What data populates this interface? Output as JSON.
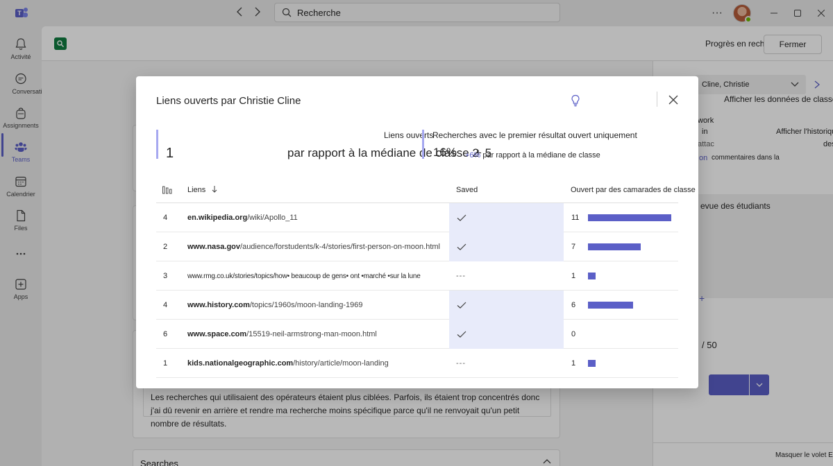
{
  "titlebar": {
    "search_placeholder": "Recherche"
  },
  "rail": {
    "items": [
      {
        "label": "Activité",
        "icon": "bell-icon"
      },
      {
        "label": "Conversation",
        "icon": "chat-icon"
      },
      {
        "label": "Assignments",
        "icon": "backpack-icon"
      },
      {
        "label": "Teams",
        "icon": "teams-people-icon"
      },
      {
        "label": "Calendrier",
        "icon": "calendar-icon"
      },
      {
        "label": "Files",
        "icon": "file-icon"
      },
      {
        "label": "",
        "icon": "more-icon"
      },
      {
        "label": "Apps",
        "icon": "apps-icon"
      }
    ]
  },
  "main": {
    "progress_title": "Progrès en recherche",
    "close_label": "Fermer",
    "student_select": "Cline, Christie",
    "show_class_data": "Afficher les données de classe",
    "right_frag_work": "work",
    "right_frag_in": "in",
    "right_frag_history": "Afficher l'historique",
    "right_frag_attach": "attac",
    "right_frag_des": "des",
    "right_frag_on": "on",
    "right_frag_comments": "commentaires dans la",
    "right_frag_review": "evue des étudiants",
    "right_frag_plus": "+",
    "score": "/ 50",
    "hide_panel": "Masquer le volet E",
    "reflection_text": "Les recherches qui utilisaient des opérateurs étaient plus ciblées. Parfois, ils étaient trop concentrés donc j'ai dû revenir en arrière et rendre ma recherche moins spécifique parce qu'il ne renvoyait qu'un petit nombre de résultats.",
    "searches_heading": "Searches"
  },
  "modal": {
    "title": "Liens ouverts par Christie Cline",
    "stat1": {
      "value": "1",
      "label": "Liens ouverts",
      "comparison": "par rapport à la médiane de classe 2"
    },
    "stat2": {
      "value": "16%",
      "label": "Recherches avec le premier résultat ouvert uniquement",
      "comparison_pct": "+ 5",
      "comparison_pct2": "+6%",
      "comparison": "par rapport à la médiane de classe"
    },
    "table": {
      "headers": {
        "links": "Liens",
        "saved": "Saved",
        "opened_by": "Ouvert par des camarades de classe"
      },
      "max_classmates": 11,
      "rows": [
        {
          "count": "4",
          "domain": "en.wikipedia.org",
          "path": "/wiki/Apollo_11",
          "saved": true,
          "classmates": 11,
          "classmates_label": "11"
        },
        {
          "count": "2",
          "domain": "www.nasa.gov",
          "path": "/audience/forstudents/k-4/stories/first-person-on-moon.html",
          "saved": true,
          "classmates": 7,
          "classmates_label": "7"
        },
        {
          "count": "3",
          "domain": "",
          "path": "www.rmg.co.uk/stories/topics/how• beaucoup de gens• ont •marché •sur la lune",
          "saved": false,
          "classmates": 1,
          "classmates_label": "1"
        },
        {
          "count": "4",
          "domain": "www.history.com",
          "path": "/topics/1960s/moon-landing-1969",
          "saved": true,
          "classmates": 6,
          "classmates_label": "6"
        },
        {
          "count": "6",
          "domain": "www.space.com",
          "path": "/15519-neil-armstrong-man-moon.html",
          "saved": true,
          "classmates": 0,
          "classmates_label": "0"
        },
        {
          "count": "1",
          "domain": "kids.nationalgeographic.com",
          "path": "/history/article/moon-landing",
          "saved": false,
          "classmates": 1,
          "classmates_label": "1"
        }
      ],
      "unsaved_marker": "---"
    }
  },
  "colors": {
    "accent": "#5b5fc7",
    "saved_bg": "#e8ebfa",
    "stat_bar": "#a6a8f0"
  }
}
